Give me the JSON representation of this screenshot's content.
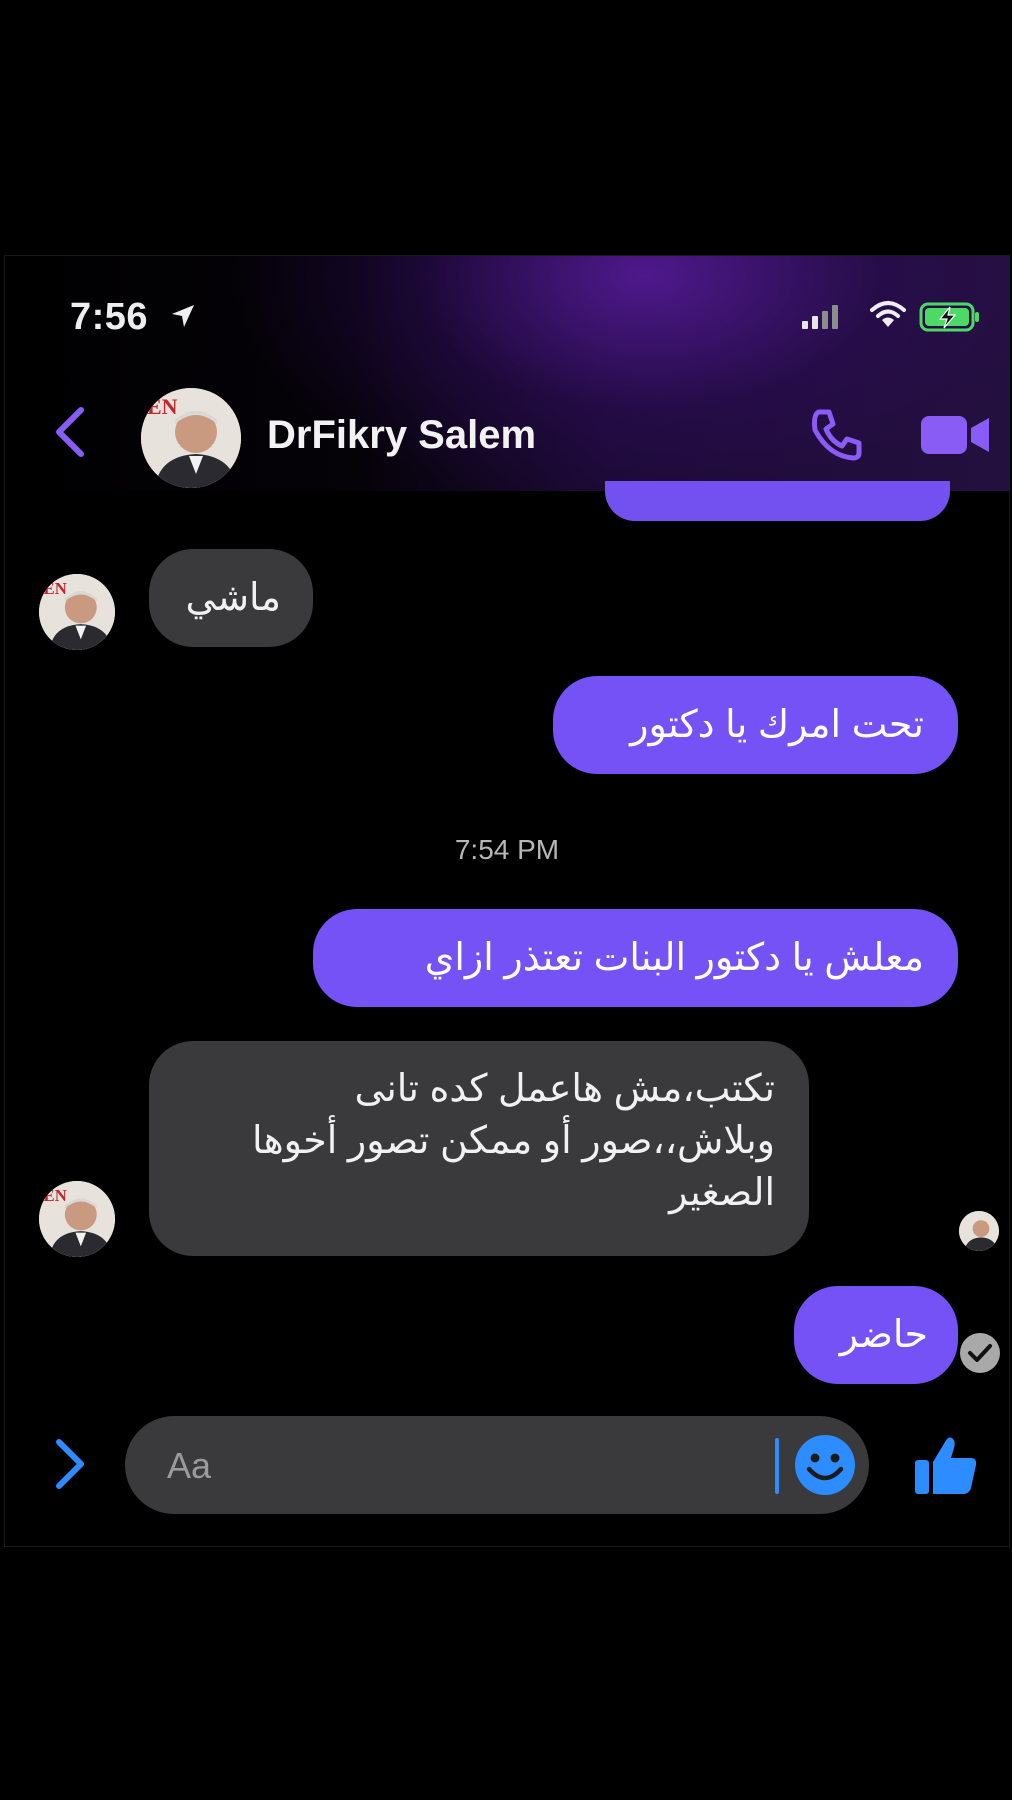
{
  "status_bar": {
    "time": "7:56"
  },
  "header": {
    "contact_name": "DrFikry Salem"
  },
  "messages": [
    {
      "direction": "in",
      "text": "ماشي"
    },
    {
      "direction": "out",
      "text": "تحت امرك يا دكتور"
    },
    {
      "direction": "out",
      "text": "معلش يا دكتور البنات تعتذر ازاي"
    },
    {
      "direction": "in",
      "lines": [
        "تكتب،مش هاعمل  كده تانى",
        "وبلاش،،صور أو ممكن تصور أخوها",
        "الصغير"
      ]
    },
    {
      "direction": "out",
      "text": "حاضر"
    }
  ],
  "timestamp": "7:54 PM",
  "composer": {
    "placeholder": "Aa"
  },
  "colors": {
    "accent": "#7552f6",
    "incoming_bubble": "#3a3a3c",
    "icon_purple": "#8a5cf6",
    "link_blue": "#2d8cff"
  },
  "icons": [
    "location-arrow-icon",
    "signal-icon",
    "wifi-icon",
    "battery-charging-icon",
    "back-chevron-icon",
    "phone-icon",
    "video-camera-icon",
    "expand-chevron-icon",
    "emoji-icon",
    "thumbs-up-icon",
    "sent-check-icon"
  ]
}
